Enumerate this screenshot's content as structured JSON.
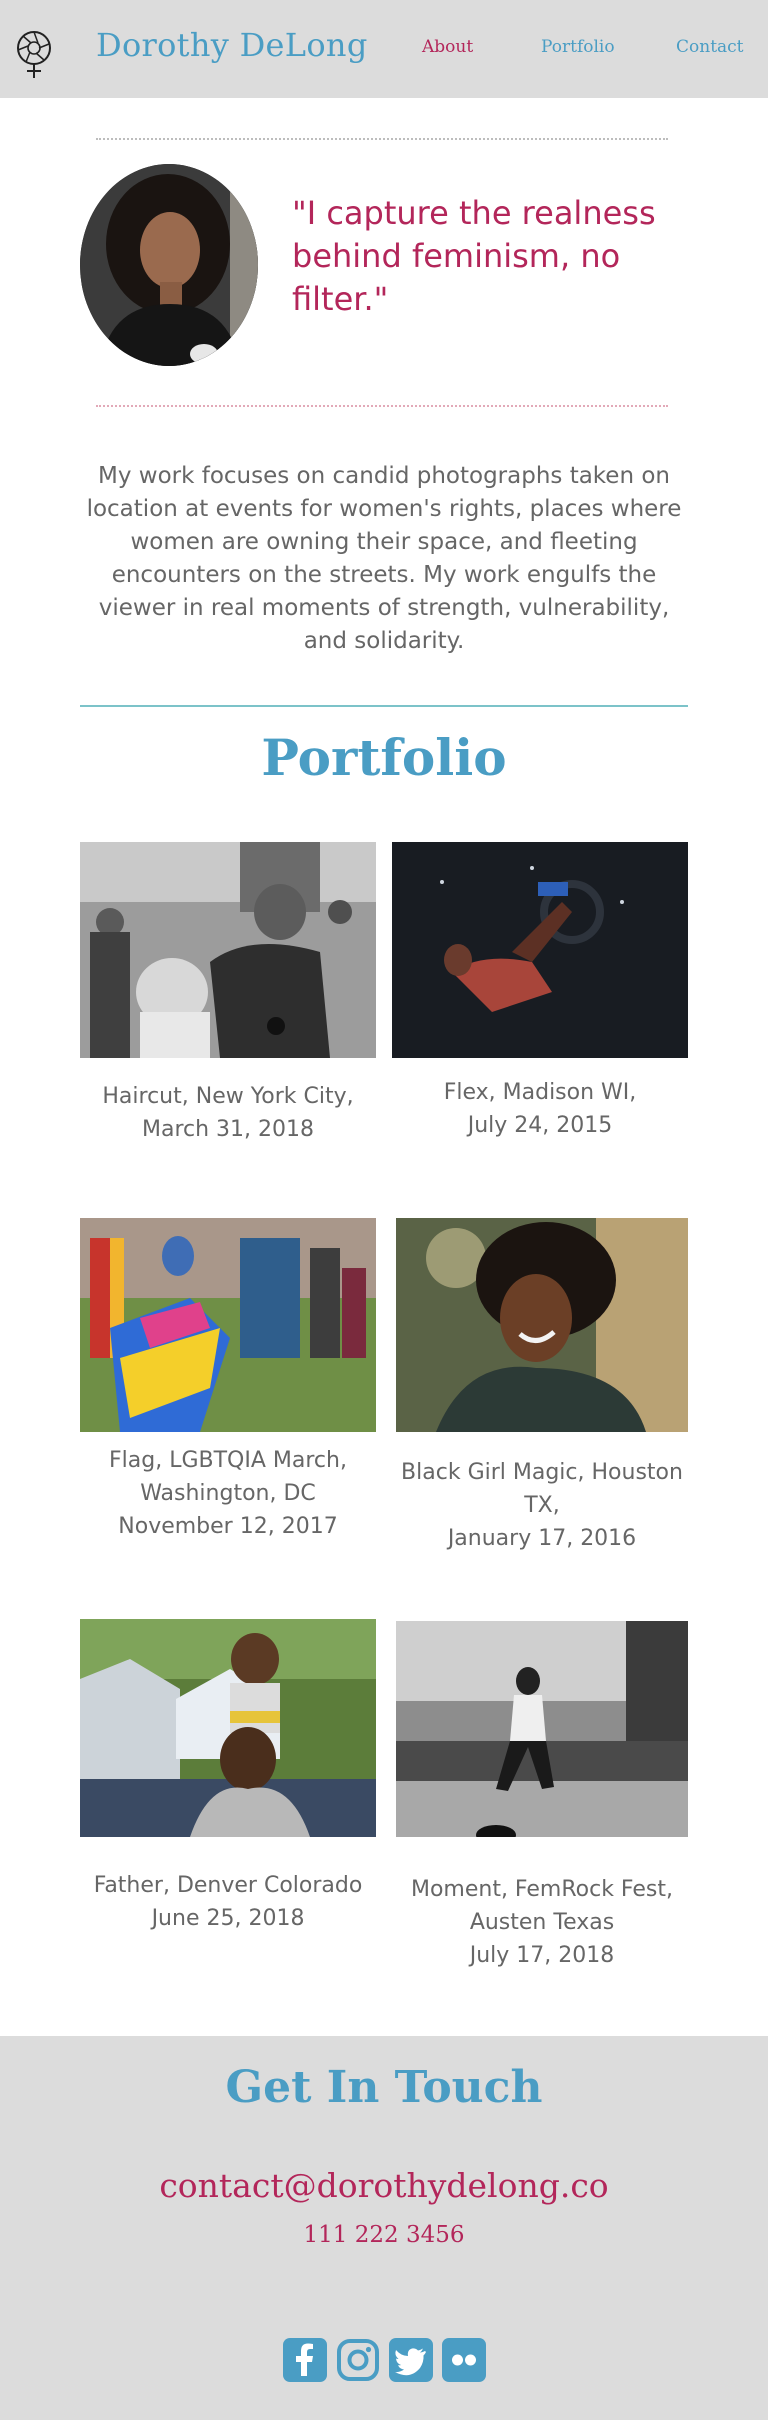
{
  "header": {
    "brand": "Dorothy DeLong",
    "nav": {
      "about": "About",
      "portfolio": "Portfolio",
      "contact": "Contact"
    }
  },
  "hero": {
    "quote": "\"I capture the realness behind feminism, no filter.\"",
    "about": "My work focuses on candid photographs taken on location at events for women's rights, places where women are owning their space, and fleeting encounters on the streets. My work engulfs the viewer in real moments of strength, vulnerability, and solidarity."
  },
  "portfolio": {
    "title": "Portfolio",
    "items": [
      {
        "caption": "Haircut, New York City,\nMarch 31, 2018"
      },
      {
        "caption": "Flex, Madison WI,\nJuly 24, 2015"
      },
      {
        "caption": "Flag, LGBTQIA March,\nWashington, DC\nNovember 12, 2017"
      },
      {
        "caption": "Black Girl Magic, Houston\nTX,\nJanuary 17, 2016"
      },
      {
        "caption": "Father, Denver Colorado\nJune 25, 2018"
      },
      {
        "caption": "Moment, FemRock Fest,\nAusten Texas\nJuly 17, 2018"
      }
    ]
  },
  "contact": {
    "title": "Get In Touch",
    "email": "contact@dorothydelong.co",
    "phone": "111 222 3456"
  },
  "icons": {
    "logo": "venus-aperture-icon",
    "social": [
      "facebook-icon",
      "instagram-icon",
      "twitter-icon",
      "flickr-icon"
    ]
  },
  "colors": {
    "accent_blue": "#4a9dc4",
    "accent_magenta": "#b3265a",
    "header_bg": "#dcdcdc",
    "text_gray": "#666666",
    "rule_teal": "#7cc3c9"
  }
}
